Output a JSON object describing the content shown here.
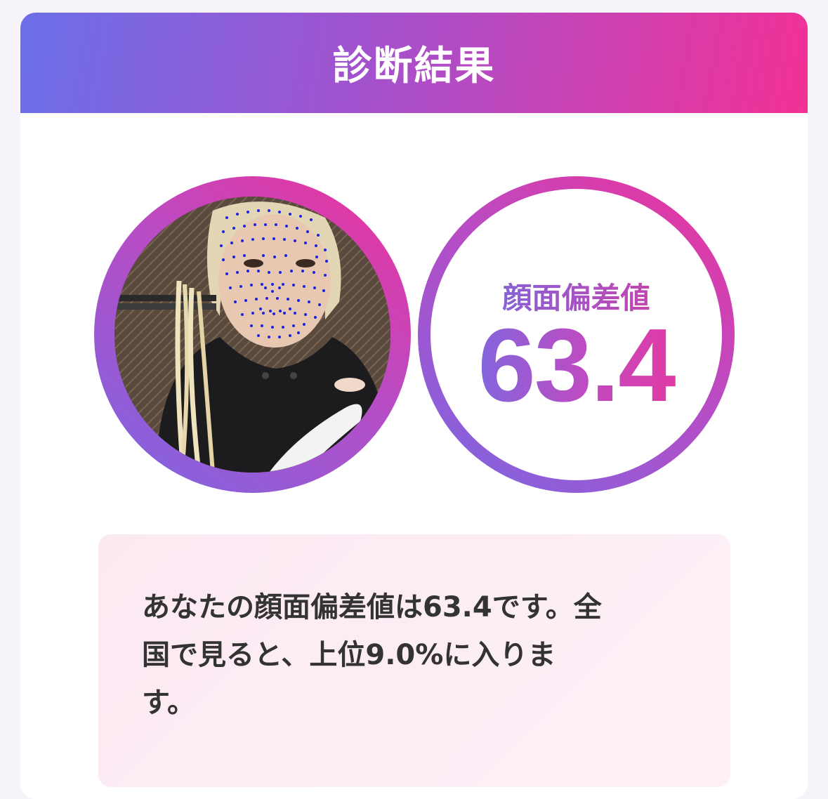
{
  "header": {
    "title": "診断結果"
  },
  "photo": {
    "alt": "face-photo-with-landmarks"
  },
  "score": {
    "label": "顔面偏差値",
    "value": "63.4"
  },
  "result": {
    "lines": [
      "あなたの顔面偏差値は63.4です。全",
      "国で見ると、上位9.0%に入りま",
      "す。"
    ]
  },
  "colors": {
    "gradient_start": "#6a6fe8",
    "gradient_mid": "#a451cd",
    "gradient_end": "#f23196",
    "text_dark": "#333333",
    "landmark_dots": "#1a22e0"
  }
}
